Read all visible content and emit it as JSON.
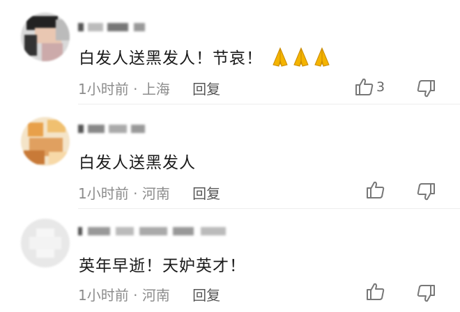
{
  "comments": [
    {
      "text": "白发人送黑发人！节哀！",
      "emoji": "folded-hands-icon x3",
      "time": "1小时前",
      "separator": "·",
      "location": "上海",
      "reply_label": "回复",
      "like_count": "3"
    },
    {
      "text": "白发人送黑发人",
      "time": "1小时前",
      "separator": "·",
      "location": "河南",
      "reply_label": "回复",
      "like_count": ""
    },
    {
      "text": "英年早逝！天妒英才！",
      "time": "1小时前",
      "separator": "·",
      "location": "河南",
      "reply_label": "回复",
      "like_count": ""
    }
  ],
  "colors": {
    "text": "#1a1a1a",
    "meta": "#8c8c8c",
    "emoji": "#f4b400"
  }
}
